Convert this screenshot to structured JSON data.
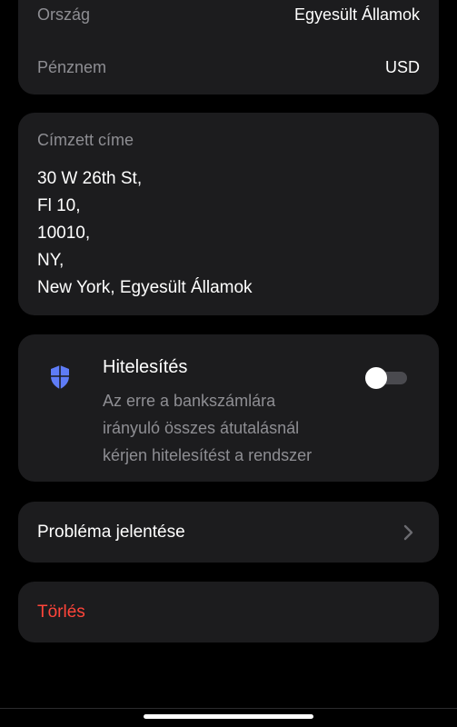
{
  "country_currency": {
    "country_label": "Ország",
    "country_value": "Egyesült Államok",
    "currency_label": "Pénznem",
    "currency_value": "USD"
  },
  "address": {
    "label": "Címzett címe",
    "lines": [
      "30 W 26th St,",
      "Fl 10,",
      "10010,",
      "NY,",
      "New York, Egyesült Államok"
    ]
  },
  "authentication": {
    "title": "Hitelesítés",
    "description_lines": [
      "Az erre a bankszámlára",
      "irányuló összes átutalásnál",
      "kérjen hitelesítést a rendszer"
    ],
    "toggle_on": false,
    "icon": "shield-icon"
  },
  "report": {
    "label": "Probléma jelentése",
    "icon": "chevron-right-icon"
  },
  "delete": {
    "label": "Törlés",
    "color": "#ff453a"
  },
  "colors": {
    "background": "#000000",
    "card": "#1c1c1e",
    "secondary_text": "#8e8e93",
    "accent_shield": "#5e7cf7"
  }
}
